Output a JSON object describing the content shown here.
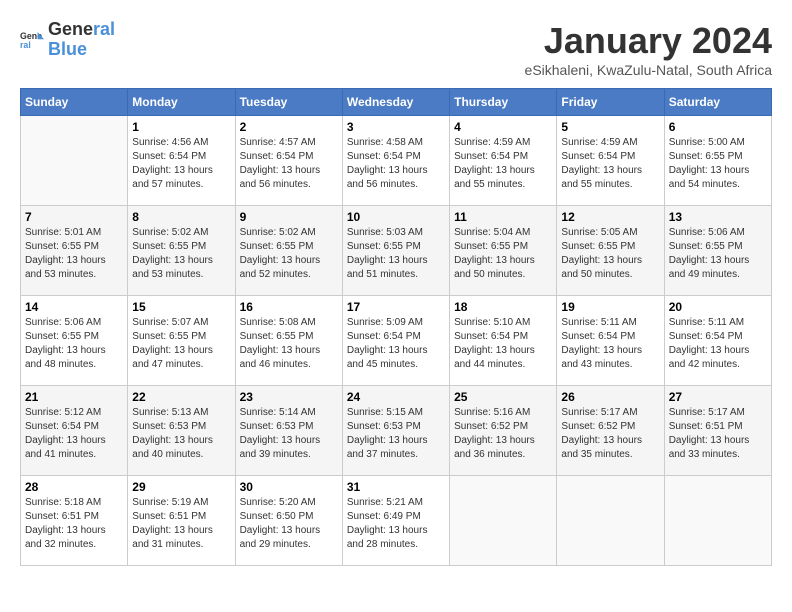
{
  "header": {
    "logo_general": "General",
    "logo_blue": "Blue",
    "title": "January 2024",
    "location": "eSikhaleni, KwaZulu-Natal, South Africa"
  },
  "calendar": {
    "weekdays": [
      "Sunday",
      "Monday",
      "Tuesday",
      "Wednesday",
      "Thursday",
      "Friday",
      "Saturday"
    ],
    "weeks": [
      [
        {
          "day": "",
          "info": ""
        },
        {
          "day": "1",
          "info": "Sunrise: 4:56 AM\nSunset: 6:54 PM\nDaylight: 13 hours\nand 57 minutes."
        },
        {
          "day": "2",
          "info": "Sunrise: 4:57 AM\nSunset: 6:54 PM\nDaylight: 13 hours\nand 56 minutes."
        },
        {
          "day": "3",
          "info": "Sunrise: 4:58 AM\nSunset: 6:54 PM\nDaylight: 13 hours\nand 56 minutes."
        },
        {
          "day": "4",
          "info": "Sunrise: 4:59 AM\nSunset: 6:54 PM\nDaylight: 13 hours\nand 55 minutes."
        },
        {
          "day": "5",
          "info": "Sunrise: 4:59 AM\nSunset: 6:54 PM\nDaylight: 13 hours\nand 55 minutes."
        },
        {
          "day": "6",
          "info": "Sunrise: 5:00 AM\nSunset: 6:55 PM\nDaylight: 13 hours\nand 54 minutes."
        }
      ],
      [
        {
          "day": "7",
          "info": "Sunrise: 5:01 AM\nSunset: 6:55 PM\nDaylight: 13 hours\nand 53 minutes."
        },
        {
          "day": "8",
          "info": "Sunrise: 5:02 AM\nSunset: 6:55 PM\nDaylight: 13 hours\nand 53 minutes."
        },
        {
          "day": "9",
          "info": "Sunrise: 5:02 AM\nSunset: 6:55 PM\nDaylight: 13 hours\nand 52 minutes."
        },
        {
          "day": "10",
          "info": "Sunrise: 5:03 AM\nSunset: 6:55 PM\nDaylight: 13 hours\nand 51 minutes."
        },
        {
          "day": "11",
          "info": "Sunrise: 5:04 AM\nSunset: 6:55 PM\nDaylight: 13 hours\nand 50 minutes."
        },
        {
          "day": "12",
          "info": "Sunrise: 5:05 AM\nSunset: 6:55 PM\nDaylight: 13 hours\nand 50 minutes."
        },
        {
          "day": "13",
          "info": "Sunrise: 5:06 AM\nSunset: 6:55 PM\nDaylight: 13 hours\nand 49 minutes."
        }
      ],
      [
        {
          "day": "14",
          "info": "Sunrise: 5:06 AM\nSunset: 6:55 PM\nDaylight: 13 hours\nand 48 minutes."
        },
        {
          "day": "15",
          "info": "Sunrise: 5:07 AM\nSunset: 6:55 PM\nDaylight: 13 hours\nand 47 minutes."
        },
        {
          "day": "16",
          "info": "Sunrise: 5:08 AM\nSunset: 6:55 PM\nDaylight: 13 hours\nand 46 minutes."
        },
        {
          "day": "17",
          "info": "Sunrise: 5:09 AM\nSunset: 6:54 PM\nDaylight: 13 hours\nand 45 minutes."
        },
        {
          "day": "18",
          "info": "Sunrise: 5:10 AM\nSunset: 6:54 PM\nDaylight: 13 hours\nand 44 minutes."
        },
        {
          "day": "19",
          "info": "Sunrise: 5:11 AM\nSunset: 6:54 PM\nDaylight: 13 hours\nand 43 minutes."
        },
        {
          "day": "20",
          "info": "Sunrise: 5:11 AM\nSunset: 6:54 PM\nDaylight: 13 hours\nand 42 minutes."
        }
      ],
      [
        {
          "day": "21",
          "info": "Sunrise: 5:12 AM\nSunset: 6:54 PM\nDaylight: 13 hours\nand 41 minutes."
        },
        {
          "day": "22",
          "info": "Sunrise: 5:13 AM\nSunset: 6:53 PM\nDaylight: 13 hours\nand 40 minutes."
        },
        {
          "day": "23",
          "info": "Sunrise: 5:14 AM\nSunset: 6:53 PM\nDaylight: 13 hours\nand 39 minutes."
        },
        {
          "day": "24",
          "info": "Sunrise: 5:15 AM\nSunset: 6:53 PM\nDaylight: 13 hours\nand 37 minutes."
        },
        {
          "day": "25",
          "info": "Sunrise: 5:16 AM\nSunset: 6:52 PM\nDaylight: 13 hours\nand 36 minutes."
        },
        {
          "day": "26",
          "info": "Sunrise: 5:17 AM\nSunset: 6:52 PM\nDaylight: 13 hours\nand 35 minutes."
        },
        {
          "day": "27",
          "info": "Sunrise: 5:17 AM\nSunset: 6:51 PM\nDaylight: 13 hours\nand 33 minutes."
        }
      ],
      [
        {
          "day": "28",
          "info": "Sunrise: 5:18 AM\nSunset: 6:51 PM\nDaylight: 13 hours\nand 32 minutes."
        },
        {
          "day": "29",
          "info": "Sunrise: 5:19 AM\nSunset: 6:51 PM\nDaylight: 13 hours\nand 31 minutes."
        },
        {
          "day": "30",
          "info": "Sunrise: 5:20 AM\nSunset: 6:50 PM\nDaylight: 13 hours\nand 29 minutes."
        },
        {
          "day": "31",
          "info": "Sunrise: 5:21 AM\nSunset: 6:49 PM\nDaylight: 13 hours\nand 28 minutes."
        },
        {
          "day": "",
          "info": ""
        },
        {
          "day": "",
          "info": ""
        },
        {
          "day": "",
          "info": ""
        }
      ]
    ]
  }
}
